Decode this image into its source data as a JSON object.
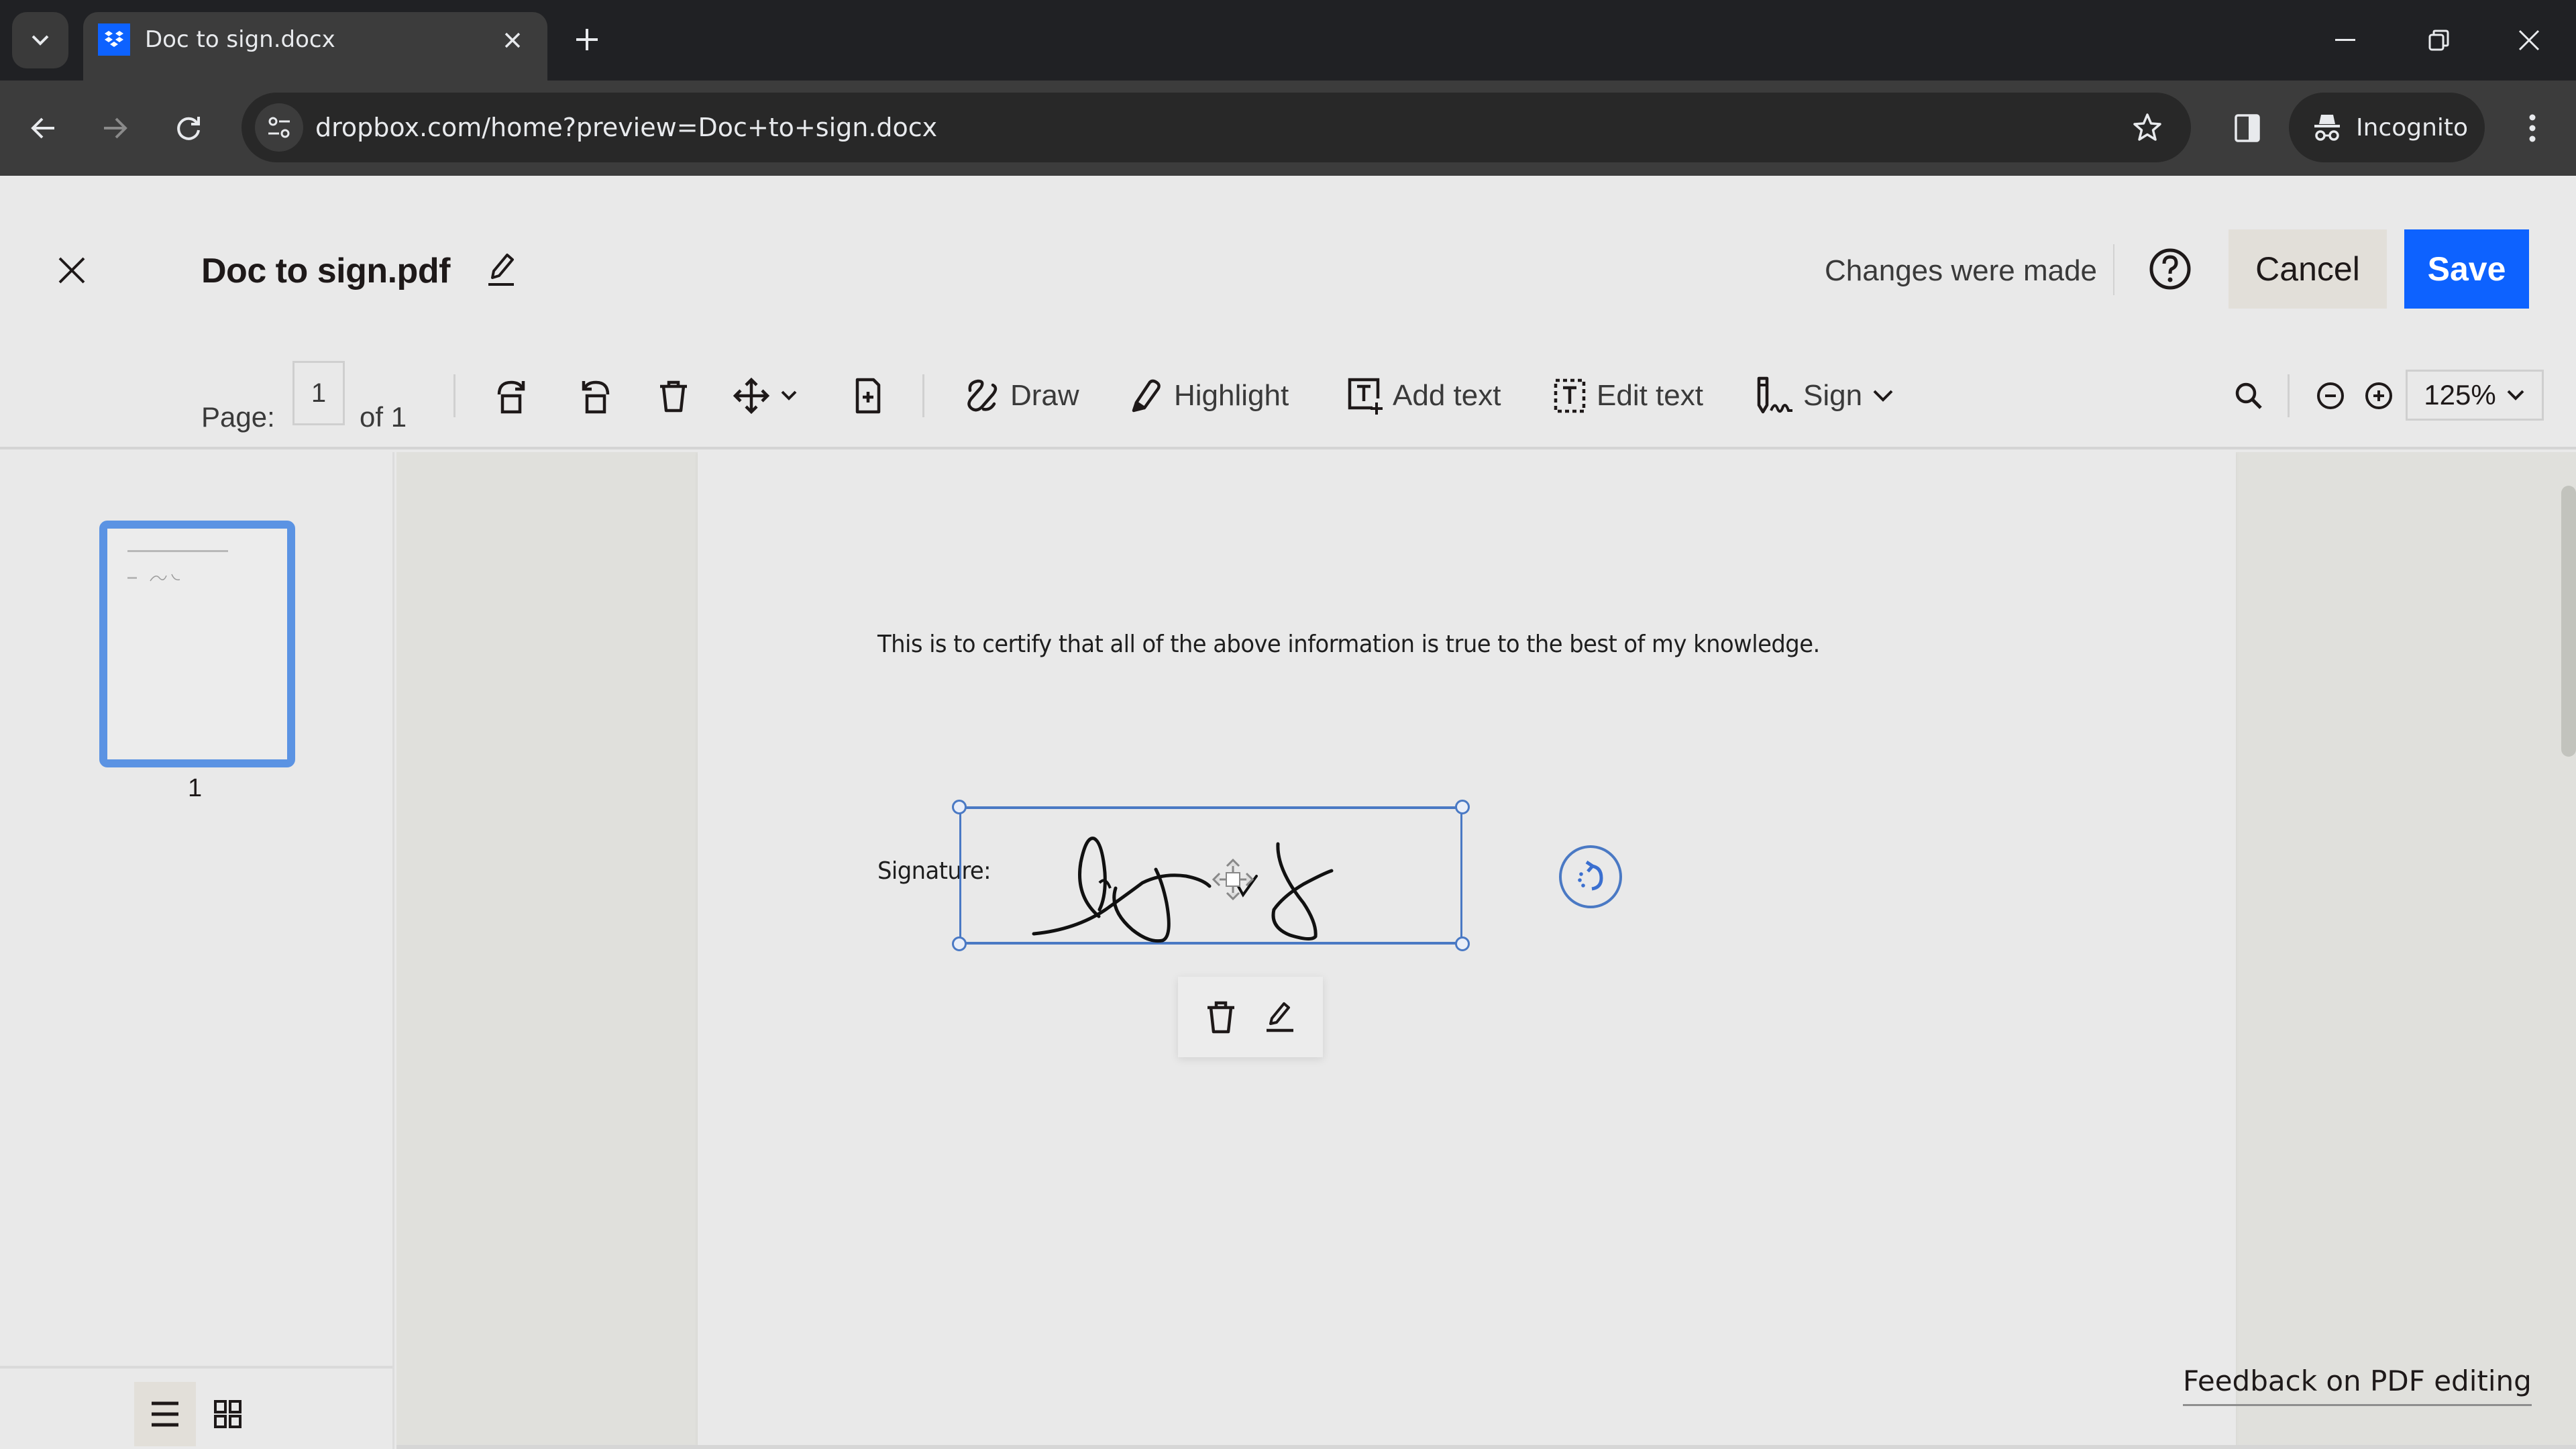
{
  "browser": {
    "tab": {
      "title": "Doc to sign.docx",
      "favicon": "dropbox-icon"
    },
    "new_tab_label": "+",
    "url": "dropbox.com/home?preview=Doc+to+sign.docx",
    "incognito_label": "Incognito",
    "window_controls": [
      "minimize",
      "restore",
      "close"
    ]
  },
  "header": {
    "document_title": "Doc to sign.pdf",
    "status": "Changes were made",
    "cancel_label": "Cancel",
    "save_label": "Save",
    "help_icon": "question-circle-icon"
  },
  "toolbar": {
    "page_label": "Page:",
    "page_value": "1",
    "page_of": "of 1",
    "page_actions": [
      "rotate-clockwise",
      "rotate-counterclockwise",
      "delete-page",
      "move",
      "insert-page"
    ],
    "tools": [
      {
        "label": "Draw",
        "icon": "draw-icon"
      },
      {
        "label": "Highlight",
        "icon": "highlighter-icon"
      },
      {
        "label": "Add text",
        "icon": "add-text-icon"
      },
      {
        "label": "Edit text",
        "icon": "edit-text-icon"
      },
      {
        "label": "Sign",
        "icon": "sign-icon",
        "has_dropdown": true
      }
    ],
    "zoom_value": "125%"
  },
  "sidebar": {
    "thumbnails": [
      {
        "page_number": "1",
        "selected": true
      }
    ],
    "view_modes": [
      {
        "name": "list",
        "active": true
      },
      {
        "name": "grid",
        "active": false
      }
    ]
  },
  "document": {
    "certification_text": "This is to certify that all of the above information is true to the best of my knowledge.",
    "signature_label": "Signature:",
    "signature_selected": true
  },
  "footer": {
    "feedback_link": "Feedback on PDF editing"
  },
  "colors": {
    "accent": "#0d62ff",
    "selection": "#4a79c4",
    "thumbnail_border": "#5b93e3"
  }
}
